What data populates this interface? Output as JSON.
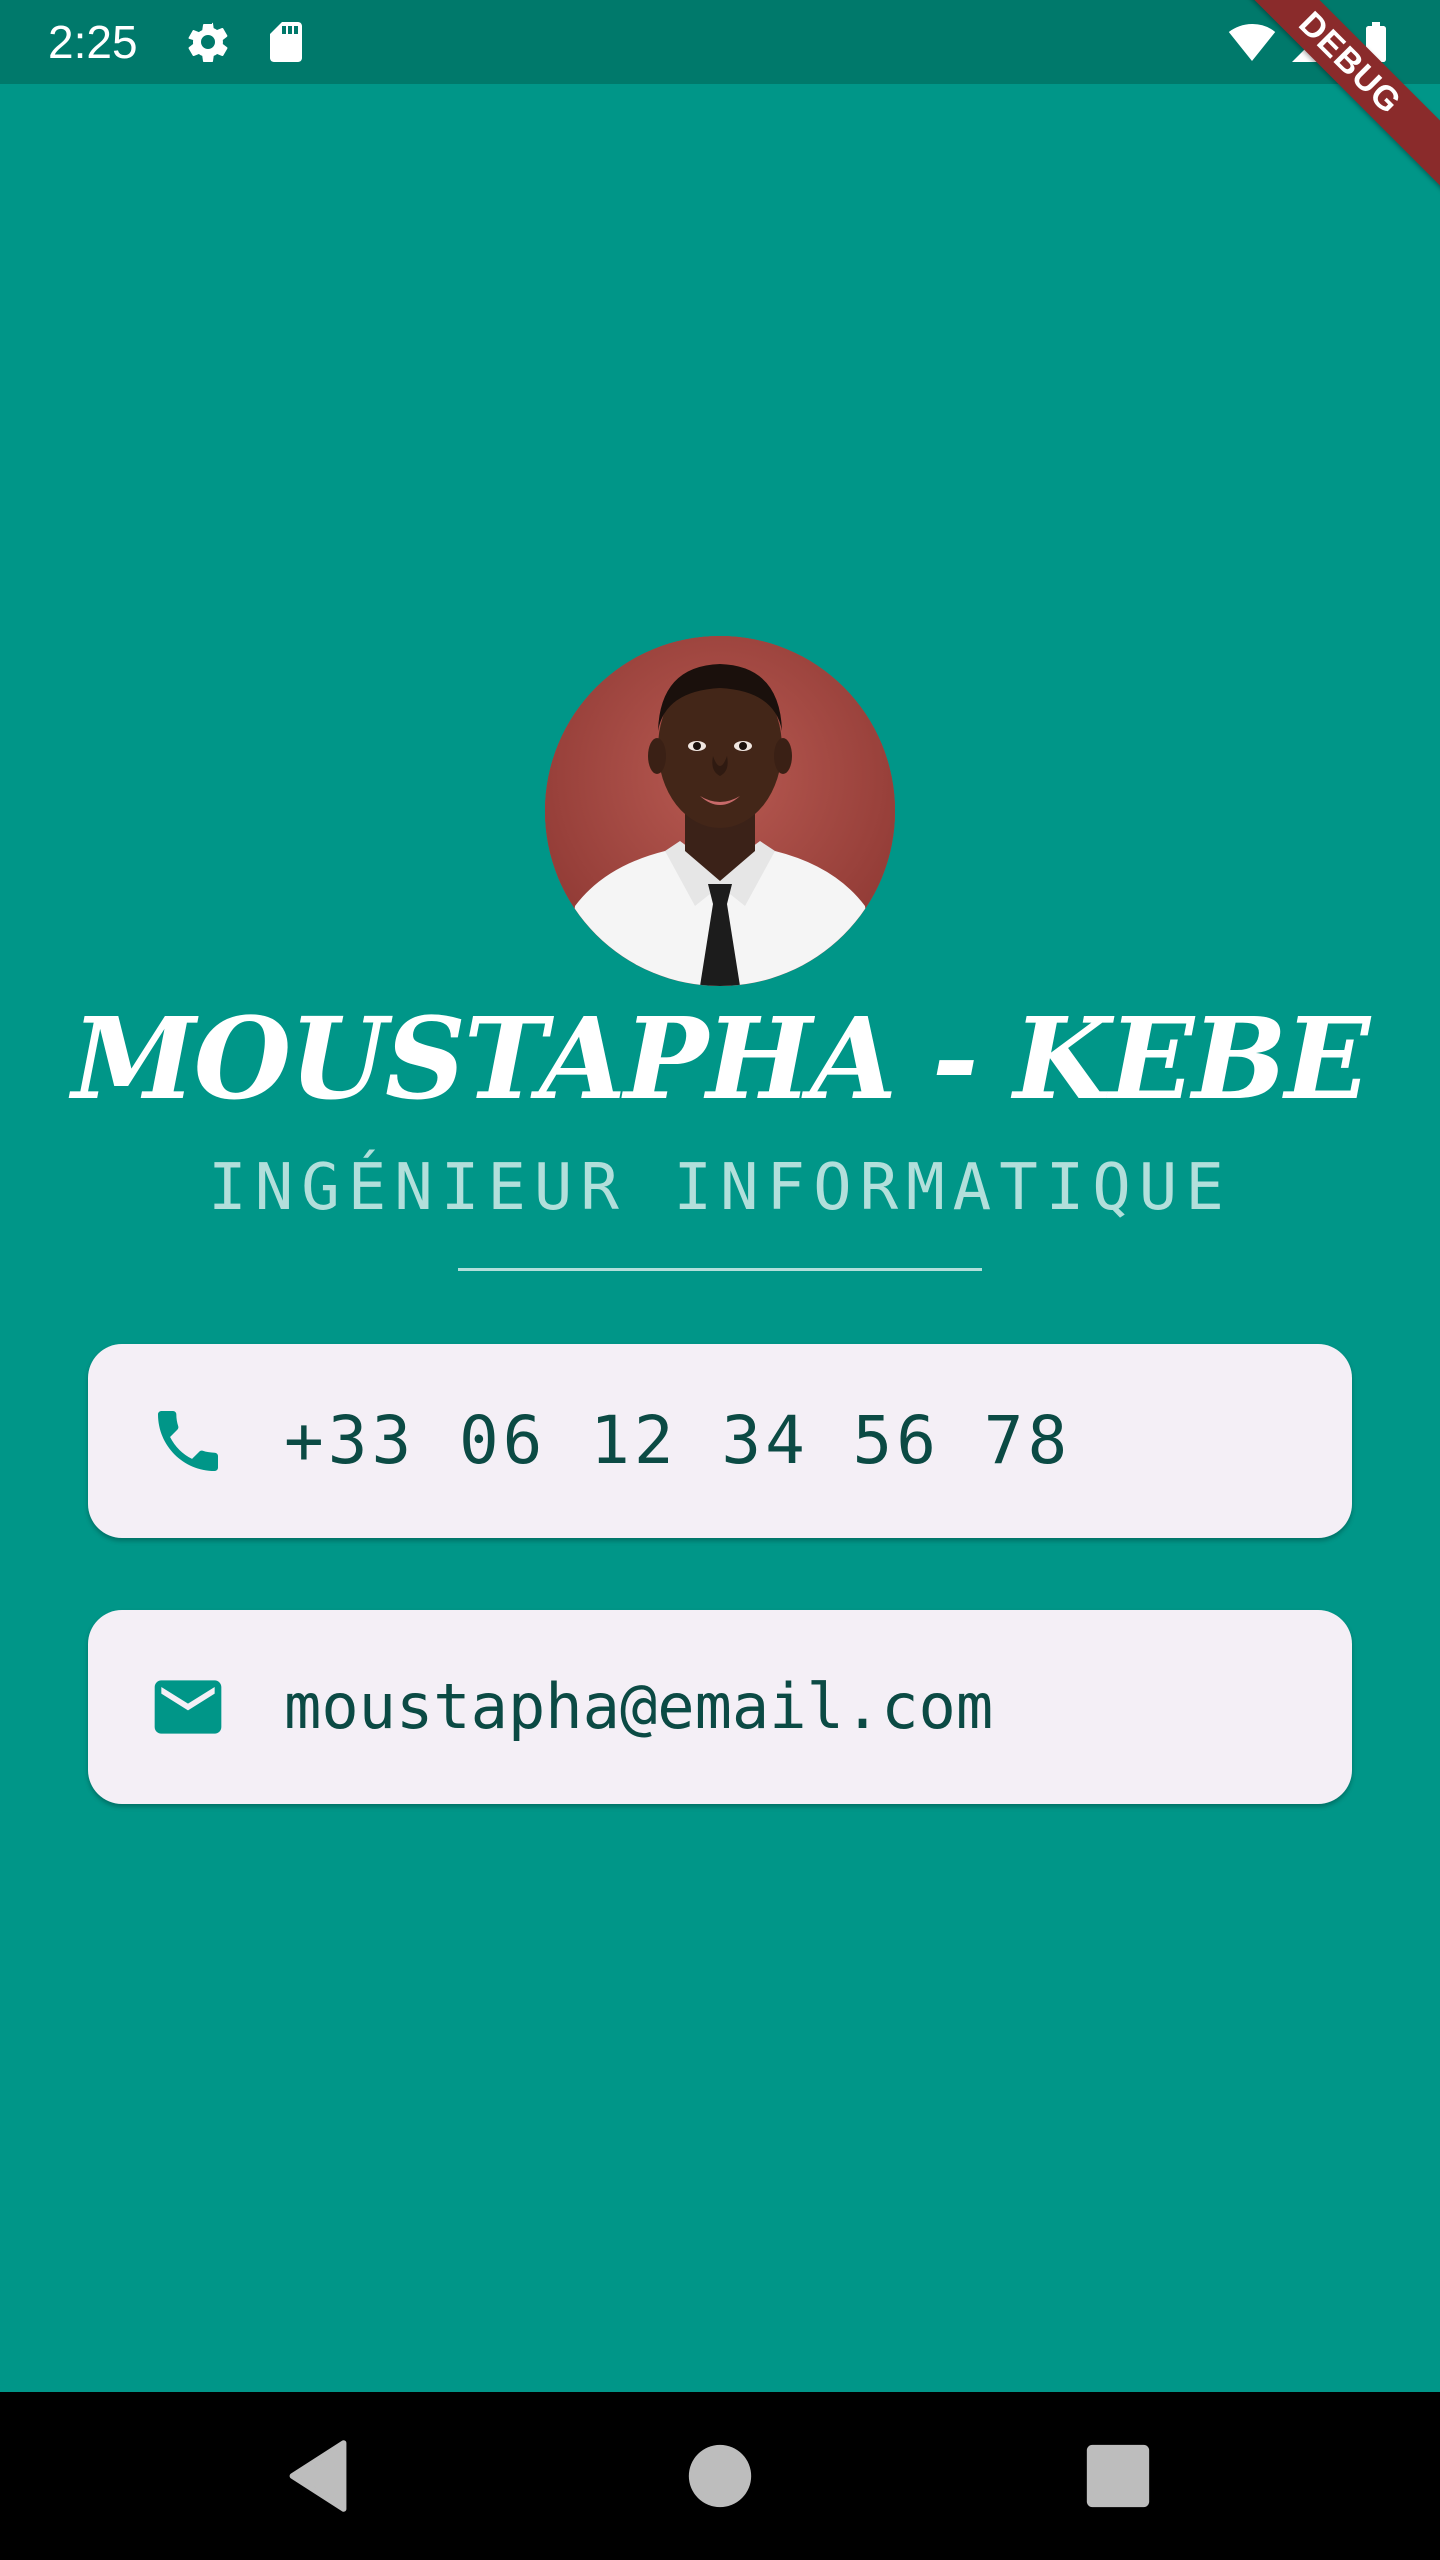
{
  "status_bar": {
    "time": "2:25",
    "icons": [
      "gear-icon",
      "sd-card-icon",
      "wifi-icon",
      "signal-icon",
      "battery-icon"
    ],
    "debug_label": "DEBUG"
  },
  "profile": {
    "name": "MOUSTAPHA - KEBE",
    "title": "INGÉNIEUR INFORMATIQUE",
    "avatar_icon": "profile-photo"
  },
  "contacts": {
    "phone": {
      "icon": "phone-icon",
      "value": "+33 06 12 34 56 78"
    },
    "email": {
      "icon": "mail-icon",
      "value": "moustapha@email.com"
    }
  },
  "nav_bar": {
    "icons": [
      "back-icon",
      "home-icon",
      "recents-icon"
    ]
  },
  "colors": {
    "background": "#009688",
    "status_bar": "#00796B",
    "card": "#f4eff6",
    "accent": "#009688",
    "card_text": "#0b4a44",
    "subtitle": "#b2dfdb"
  }
}
